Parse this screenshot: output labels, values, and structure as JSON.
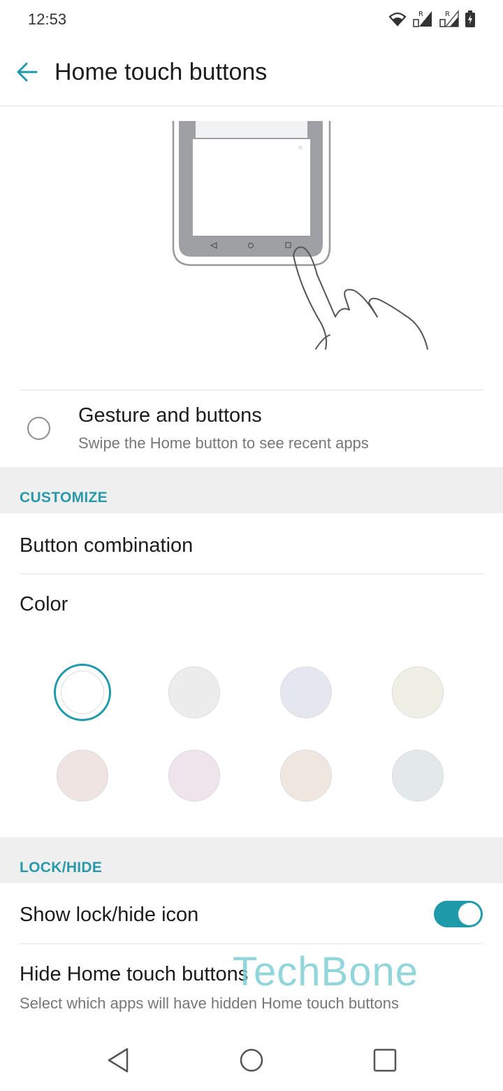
{
  "status_bar": {
    "time": "12:53",
    "icons": [
      "wifi-icon",
      "signal-icon",
      "signal-icon",
      "battery-icon"
    ],
    "roaming_label": "R"
  },
  "app_bar": {
    "title": "Home touch buttons",
    "back_icon": "arrow-left-icon"
  },
  "options": [
    {
      "title": "Gesture and buttons",
      "subtitle": "Swipe the Home button to see recent apps",
      "selected": false
    }
  ],
  "customize": {
    "header": "CUSTOMIZE",
    "button_combination_label": "Button combination",
    "color_label": "Color",
    "swatches": [
      {
        "color": "#ffffff",
        "selected": true
      },
      {
        "color": "#ececec",
        "selected": false
      },
      {
        "color": "#e4e7f0",
        "selected": false
      },
      {
        "color": "#f0efe6",
        "selected": false
      },
      {
        "color": "#efe4e2",
        "selected": false
      },
      {
        "color": "#efe3ec",
        "selected": false
      },
      {
        "color": "#f0e6e0",
        "selected": false
      },
      {
        "color": "#e3e9ea",
        "selected": false
      }
    ]
  },
  "lock_hide": {
    "header": "LOCK/HIDE",
    "show_icon_label": "Show lock/hide icon",
    "show_icon_enabled": true,
    "hide_buttons_label": "Hide Home touch buttons",
    "hide_buttons_sub": "Select which apps will have hidden Home touch buttons"
  },
  "watermark": "TechBone",
  "accent_color": "#1e9aab",
  "nav_bar": {
    "icons": [
      "back-triangle-icon",
      "home-circle-icon",
      "recents-square-icon"
    ]
  }
}
